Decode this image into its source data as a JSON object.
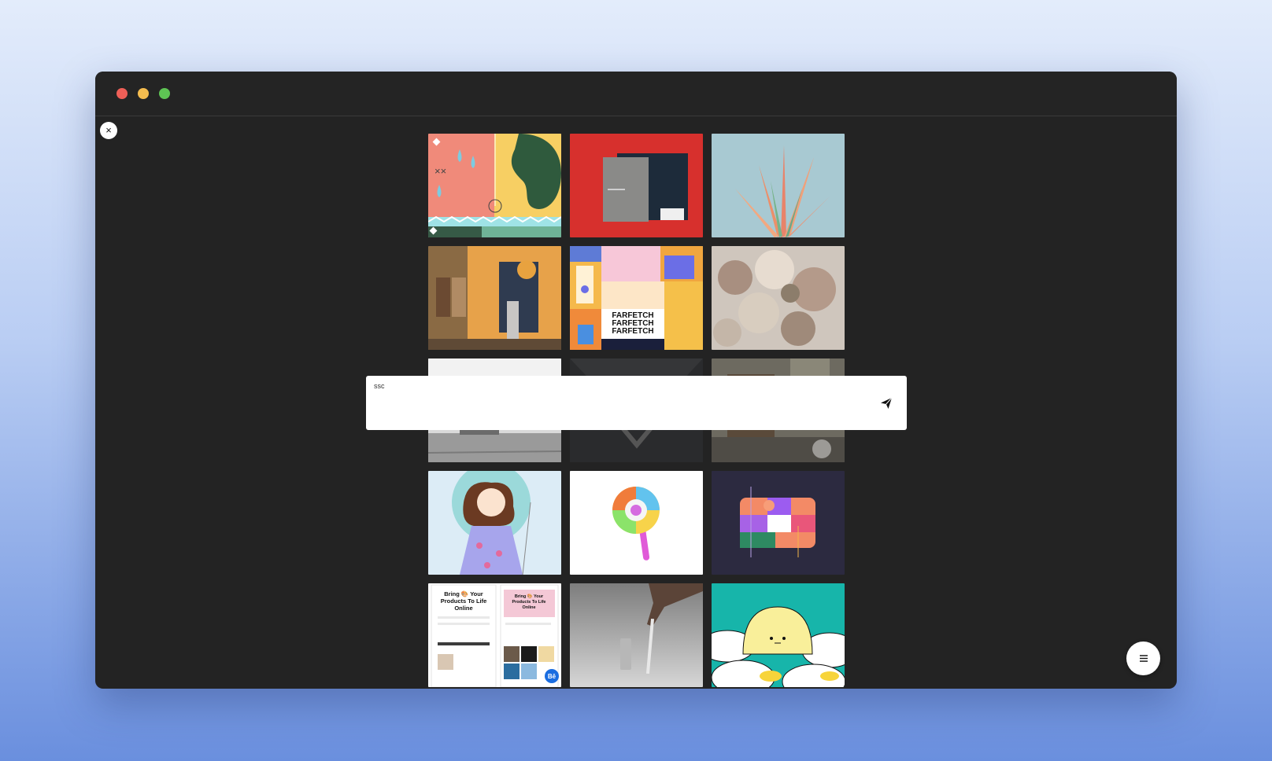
{
  "window": {
    "controls": [
      "close",
      "minimize",
      "zoom"
    ]
  },
  "overlay": {
    "close_label": "×"
  },
  "prompt": {
    "label": "ssc",
    "value": "",
    "send_icon": "paper-plane-icon"
  },
  "tiles": {
    "t5": {
      "lines": [
        "FARFETCH",
        "FARFETCH",
        "FARFETCH"
      ]
    },
    "t13": {
      "headline_left": [
        "Bring 🎨 Your",
        "Products To Life",
        "Online"
      ],
      "headline_right": [
        "Bring 🎨 Your",
        "Products To Life",
        "Online"
      ],
      "badge": "Bē"
    }
  },
  "menu": {
    "icon": "hamburger-icon"
  },
  "colors": {
    "background_top": "#e3ecfb",
    "background_bottom": "#6a8fde",
    "window": "#232323",
    "traffic_red": "#ee5f57",
    "traffic_yellow": "#f5bd4f",
    "traffic_green": "#5ec454"
  }
}
